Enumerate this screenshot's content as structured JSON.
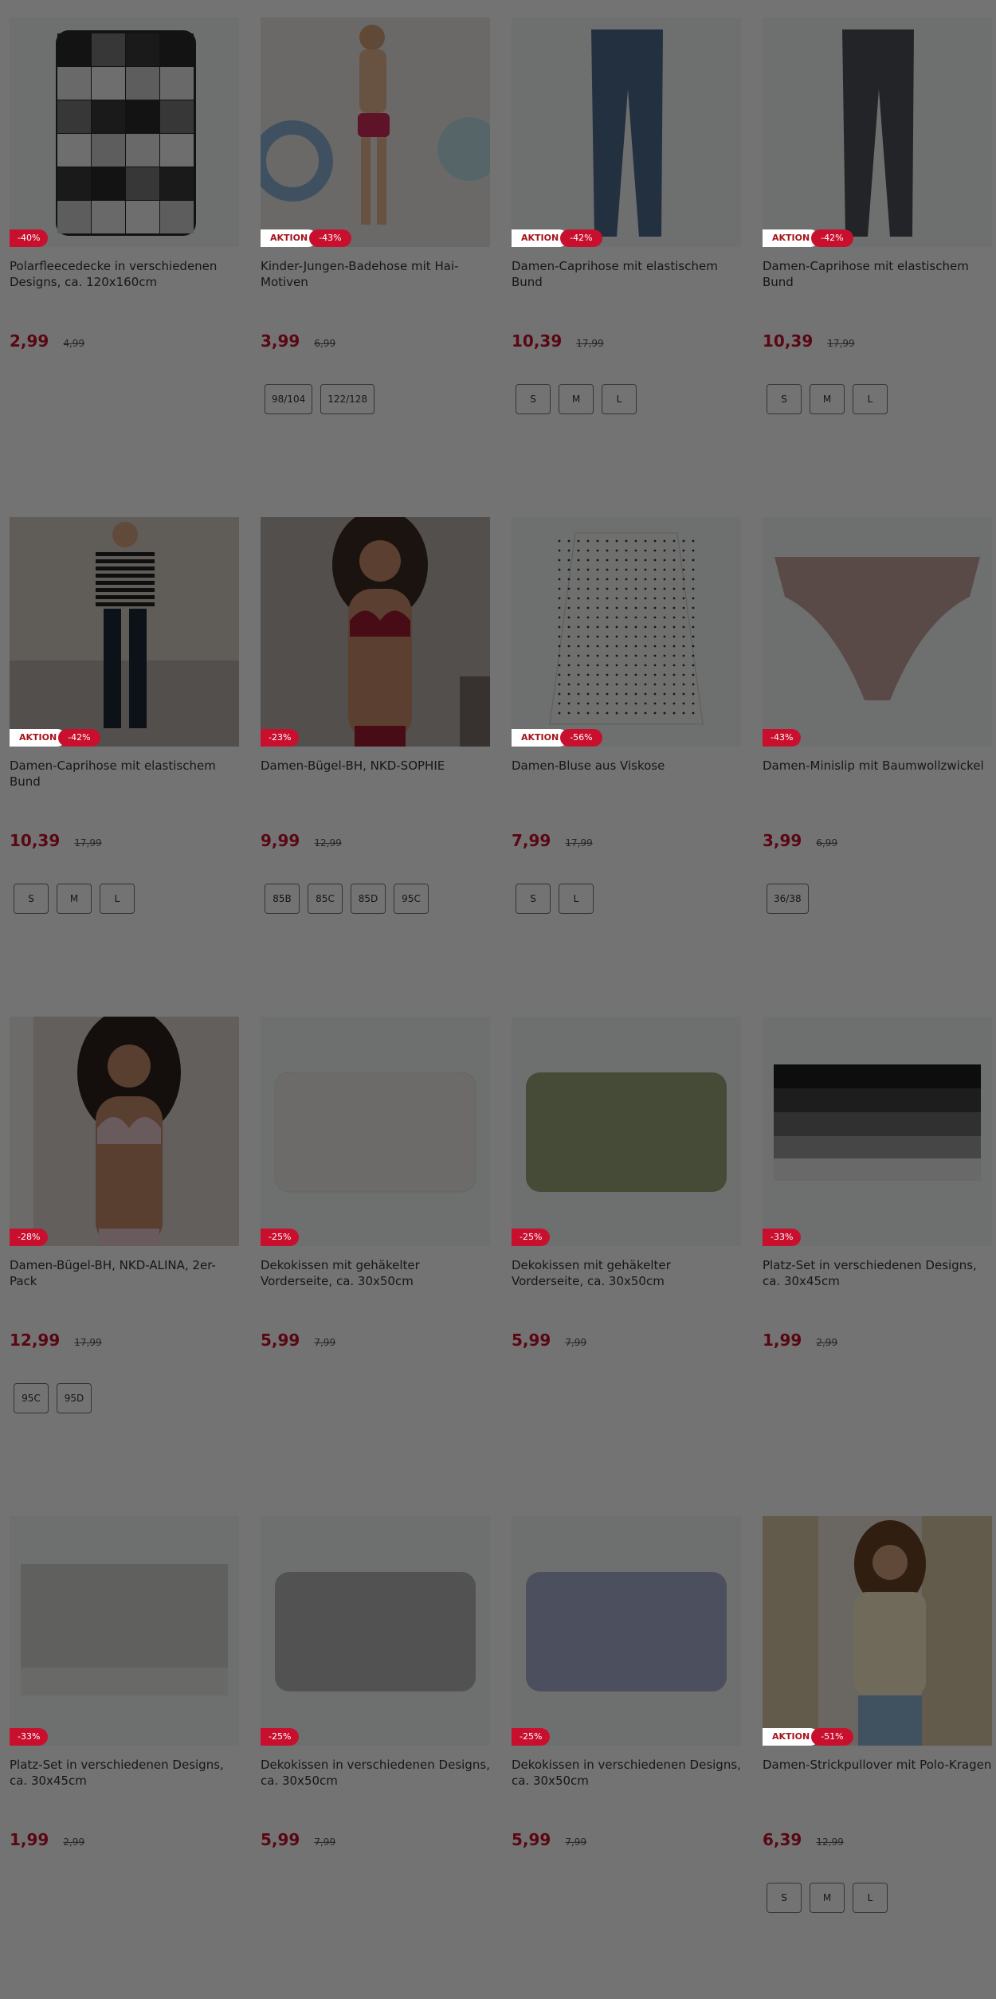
{
  "accent_color": "#c8102e",
  "overlay": "dimmed-modal-backdrop",
  "aktion_label": "AKTION",
  "products": [
    {
      "title": "Polarfleecedecke in verschiedenen Designs, ca. 120x160cm",
      "price": "2,99",
      "old_price": "4,99",
      "discount": "-40%",
      "aktion": false,
      "sizes": [],
      "image": "checkered-blanket"
    },
    {
      "title": "Kinder-Jungen-Badehose mit Hai-Motiven",
      "price": "3,99",
      "old_price": "6,99",
      "discount": "-43%",
      "aktion": true,
      "sizes": [
        "98/104",
        "122/128"
      ],
      "image": "boy-swim-trunks"
    },
    {
      "title": "Damen-Caprihose mit elastischem Bund",
      "price": "10,39",
      "old_price": "17,99",
      "discount": "-42%",
      "aktion": true,
      "sizes": [
        "S",
        "M",
        "L"
      ],
      "image": "blue-leggings"
    },
    {
      "title": "Damen-Caprihose mit elastischem Bund",
      "price": "10,39",
      "old_price": "17,99",
      "discount": "-42%",
      "aktion": true,
      "sizes": [
        "S",
        "M",
        "L"
      ],
      "image": "grey-leggings"
    },
    {
      "title": "Damen-Caprihose mit elastischem Bund",
      "price": "10,39",
      "old_price": "17,99",
      "discount": "-42%",
      "aktion": true,
      "sizes": [
        "S",
        "M",
        "L"
      ],
      "image": "woman-striped-sweater"
    },
    {
      "title": "Damen-Bügel-BH, NKD-SOPHIE",
      "price": "9,99",
      "old_price": "12,99",
      "discount": "-23%",
      "aktion": false,
      "sizes": [
        "85B",
        "85C",
        "85D",
        "95C"
      ],
      "image": "red-bra-model"
    },
    {
      "title": "Damen-Bluse aus Viskose",
      "price": "7,99",
      "old_price": "17,99",
      "discount": "-56%",
      "aktion": true,
      "sizes": [
        "S",
        "L"
      ],
      "image": "dotted-blouse"
    },
    {
      "title": "Damen-Minislip mit Baumwollzwickel",
      "price": "3,99",
      "old_price": "6,99",
      "discount": "-43%",
      "aktion": false,
      "sizes": [
        "36/38"
      ],
      "image": "mauve-slip"
    },
    {
      "title": "Damen-Bügel-BH, NKD-ALINA, 2er-Pack",
      "price": "12,99",
      "old_price": "17,99",
      "discount": "-28%",
      "aktion": false,
      "sizes": [
        "95C",
        "95D"
      ],
      "image": "pink-bra-model"
    },
    {
      "title": "Dekokissen mit gehäkelter Vorderseite, ca. 30x50cm",
      "price": "5,99",
      "old_price": "7,99",
      "discount": "-25%",
      "aktion": false,
      "sizes": [],
      "image": "white-crochet-cushion"
    },
    {
      "title": "Dekokissen mit gehäkelter Vorderseite, ca. 30x50cm",
      "price": "5,99",
      "old_price": "7,99",
      "discount": "-25%",
      "aktion": false,
      "sizes": [],
      "image": "green-crochet-cushion"
    },
    {
      "title": "Platz-Set in verschiedenen Designs, ca. 30x45cm",
      "price": "1,99",
      "old_price": "2,99",
      "discount": "-33%",
      "aktion": false,
      "sizes": [],
      "image": "dark-gradient-placemat"
    },
    {
      "title": "Platz-Set in verschiedenen Designs, ca. 30x45cm",
      "price": "1,99",
      "old_price": "2,99",
      "discount": "-33%",
      "aktion": false,
      "sizes": [],
      "image": "grey-placemat"
    },
    {
      "title": "Dekokissen in verschiedenen Designs, ca. 30x50cm",
      "price": "5,99",
      "old_price": "7,99",
      "discount": "-25%",
      "aktion": false,
      "sizes": [],
      "image": "grey-floral-cushion"
    },
    {
      "title": "Dekokissen in verschiedenen Designs, ca. 30x50cm",
      "price": "5,99",
      "old_price": "7,99",
      "discount": "-25%",
      "aktion": false,
      "sizes": [],
      "image": "blue-floral-cushion"
    },
    {
      "title": "Damen-Strickpullover mit Polo-Kragen",
      "price": "6,39",
      "old_price": "12,99",
      "discount": "-51%",
      "aktion": true,
      "sizes": [
        "S",
        "M",
        "L"
      ],
      "image": "woman-polo-sweater"
    }
  ]
}
